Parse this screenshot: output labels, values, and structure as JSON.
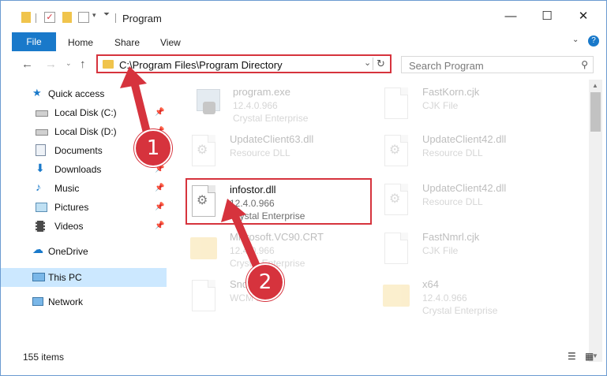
{
  "window": {
    "title": "Program",
    "minimize_icon": "minimize-icon",
    "maximize_icon": "maximize-icon",
    "close_icon": "close-icon"
  },
  "ribbon": {
    "tabs": [
      "File",
      "Home",
      "Share",
      "View"
    ],
    "help_label": "?"
  },
  "address": {
    "path": "C:\\Program Files\\Program Directory",
    "dropdown_glyph": "⌄",
    "refresh_glyph": "↻"
  },
  "search": {
    "placeholder": "Search Program"
  },
  "sidebar": {
    "quick_access": "Quick access",
    "items": [
      {
        "label": "Local Disk (C:)",
        "icon": "drive-icon",
        "pinned": true
      },
      {
        "label": "Local Disk (D:)",
        "icon": "drive-icon",
        "pinned": true
      },
      {
        "label": "Documents",
        "icon": "documents-icon",
        "pinned": true
      },
      {
        "label": "Downloads",
        "icon": "downloads-icon",
        "pinned": true
      },
      {
        "label": "Music",
        "icon": "music-icon",
        "pinned": true
      },
      {
        "label": "Pictures",
        "icon": "pictures-icon",
        "pinned": true
      },
      {
        "label": "Videos",
        "icon": "videos-icon",
        "pinned": true
      }
    ],
    "onedrive": "OneDrive",
    "this_pc": "This PC",
    "network": "Network"
  },
  "files": [
    {
      "name": "program.exe",
      "line1": "12.4.0.966",
      "line2": "Crystal Enterprise",
      "icon": "exe-icon",
      "faded": true
    },
    {
      "name": "FastKorn.cjk",
      "line1": "CJK File",
      "line2": "",
      "icon": "document-icon",
      "faded": true
    },
    {
      "name": "UpdateClient63.dll",
      "line1": "Resource DLL",
      "line2": "",
      "icon": "dll-icon",
      "faded": true
    },
    {
      "name": "UpdateClient42.dll",
      "line1": "Resource DLL",
      "line2": "",
      "icon": "dll-icon",
      "faded": true
    },
    {
      "name": "infostor.dll",
      "line1": "12.4.0.966",
      "line2": "Crystal Enterprise",
      "icon": "dll-icon",
      "faded": false
    },
    {
      "name": "UpdateClient42.dll",
      "line1": "Resource DLL",
      "line2": "",
      "icon": "dll-icon",
      "faded": true
    },
    {
      "name": "Microsoft.VC90.CRT",
      "line1": "12.4.0.966",
      "line2": "Crystal Enterprise",
      "icon": "folder-icon",
      "faded": true
    },
    {
      "name": "FastNmrl.cjk",
      "line1": "CJK File",
      "line2": "",
      "icon": "document-icon",
      "faded": true
    },
    {
      "name": "SndPlr.wcm",
      "line1": "WCM File",
      "line2": "",
      "icon": "document-icon",
      "faded": true
    },
    {
      "name": "x64",
      "line1": "12.4.0.966",
      "line2": "Crystal Enterprise",
      "icon": "folder-icon",
      "faded": true
    }
  ],
  "status": {
    "item_count": "155 items"
  },
  "annotations": {
    "step1": "1",
    "step2": "2",
    "color": "#d6333d"
  }
}
